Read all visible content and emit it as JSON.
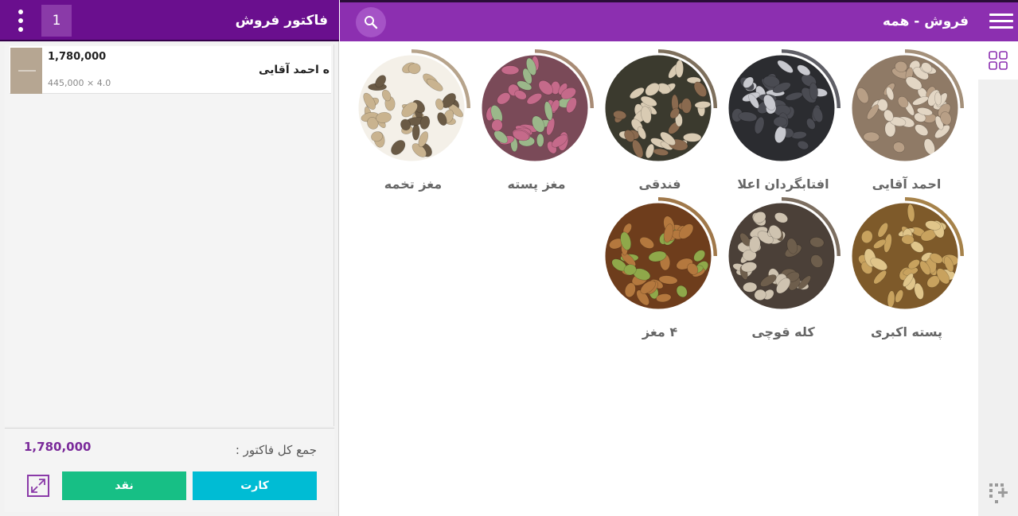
{
  "invoice": {
    "title": "فاکتور فروش",
    "count": "1",
    "items": [
      {
        "name": "ه احمد آقایی",
        "amount": "1,780,000",
        "qty_price": "4.0 × 445,000"
      }
    ],
    "total_label": "جمع کل فاکتور :",
    "total": "1,780,000",
    "buttons": {
      "card": "کارت",
      "cash": "نقد"
    }
  },
  "products_header": {
    "title": "فروش - همه"
  },
  "products": [
    {
      "label": "احمد آقایی",
      "ring": "#a4907a",
      "fill": "#e3d6c4",
      "dot": "#b89f86",
      "bg": "#8f7a66"
    },
    {
      "label": "افتابگردان اعلا",
      "ring": "#5f5f66",
      "fill": "#4a4b52",
      "dot": "#c8c9cf",
      "bg": "#2b2c30"
    },
    {
      "label": "فندقی",
      "ring": "#7d6f5c",
      "fill": "#d9cbb3",
      "dot": "#8a6a4f",
      "bg": "#3b3a2e"
    },
    {
      "label": "مغز پسته",
      "ring": "#a88b75",
      "fill": "#c56a8a",
      "dot": "#9bb78a",
      "bg": "#7a4a58"
    },
    {
      "label": "مغز تخمه",
      "ring": "#b7a48c",
      "fill": "#c9b38f",
      "dot": "#6a5a45",
      "bg": "#f4f0e8"
    },
    {
      "label": "پسته اکبری",
      "ring": "#a6824a",
      "fill": "#c8a25e",
      "dot": "#e0c58a",
      "bg": "#7e5a2a"
    },
    {
      "label": "کله قوچی",
      "ring": "#7c6e60",
      "fill": "#cfc3b0",
      "dot": "#6e5e4c",
      "bg": "#4b4038"
    },
    {
      "label": "۴ مغز",
      "ring": "#a0784a",
      "fill": "#b4783e",
      "dot": "#8fa84a",
      "bg": "#6e3d1c"
    }
  ],
  "icons": {
    "search": "search-icon",
    "menu": "hamburger-icon",
    "more": "more-vert-icon",
    "expand": "expand-icon",
    "grid": "grid-icon",
    "add": "add-grid-icon"
  },
  "colors": {
    "invoice_header": "#6a0f8e",
    "products_header": "#8c2fb0",
    "cash": "#17bf85",
    "card": "#00bcd4",
    "total": "#7a2a9a"
  }
}
